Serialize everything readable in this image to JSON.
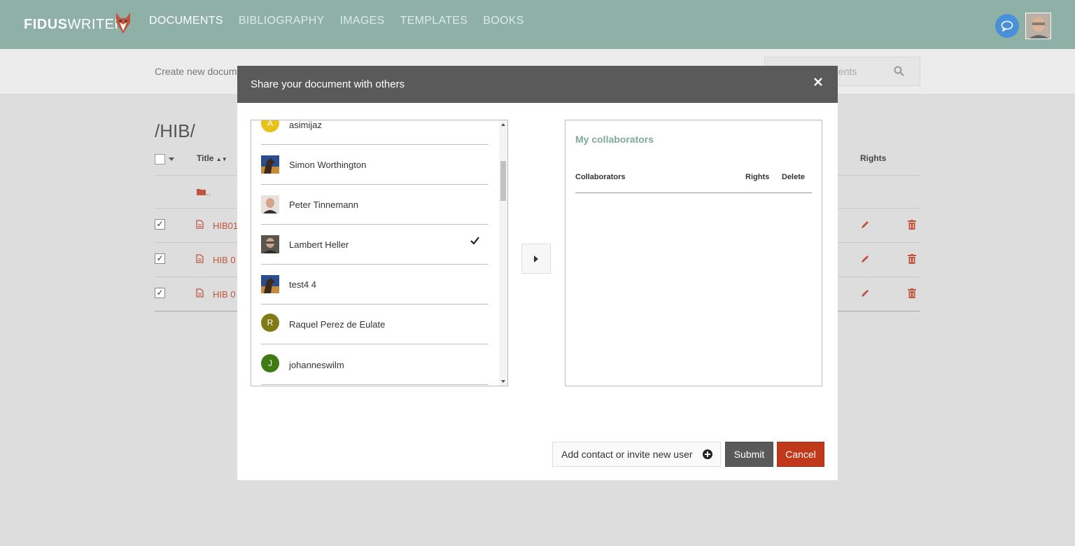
{
  "header": {
    "logo_bold": "FIDUS",
    "logo_rest": "WRITER",
    "nav": [
      {
        "label": "DOCUMENTS",
        "active": true
      },
      {
        "label": "BIBLIOGRAPHY",
        "active": false
      },
      {
        "label": "IMAGES",
        "active": false
      },
      {
        "label": "TEMPLATES",
        "active": false
      },
      {
        "label": "BOOKS",
        "active": false
      }
    ],
    "accent_color": "#8fb0a7"
  },
  "subbar": {
    "create_link": "Create new docum",
    "search_placeholder_visible": "nents"
  },
  "page": {
    "folder_title": "/HIB/",
    "col_title": "Title",
    "col_rights": "Rights",
    "parent_folder": "..",
    "rows": [
      {
        "name": "HIB01",
        "checked": true
      },
      {
        "name": "HIB 0",
        "checked": true
      },
      {
        "name": "HIB 0",
        "checked": true
      }
    ]
  },
  "dialog": {
    "title": "Share your document with others",
    "contacts": [
      {
        "name": "asimijaz",
        "letter": "A",
        "color": "#e8c21a",
        "type": "letter",
        "selected": false
      },
      {
        "name": "Simon Worthington",
        "type": "photo",
        "photo": "horse",
        "selected": false
      },
      {
        "name": "Peter Tinnemann",
        "type": "photo",
        "photo": "face-light",
        "selected": false
      },
      {
        "name": "Lambert Heller",
        "type": "photo",
        "photo": "face-dark",
        "selected": true
      },
      {
        "name": "test4 4",
        "type": "photo",
        "photo": "horse",
        "selected": false
      },
      {
        "name": "Raquel Perez de Eulate",
        "letter": "R",
        "color": "#7f7a15",
        "type": "letter",
        "selected": false
      },
      {
        "name": "johanneswilm",
        "letter": "J",
        "color": "#3f7a12",
        "type": "letter",
        "selected": false
      }
    ],
    "collab_title": "My collaborators",
    "collab_headers": {
      "collaborators": "Collaborators",
      "rights": "Rights",
      "delete": "Delete"
    },
    "add_contact_label": "Add contact or invite new user",
    "submit_label": "Submit",
    "cancel_label": "Cancel"
  }
}
